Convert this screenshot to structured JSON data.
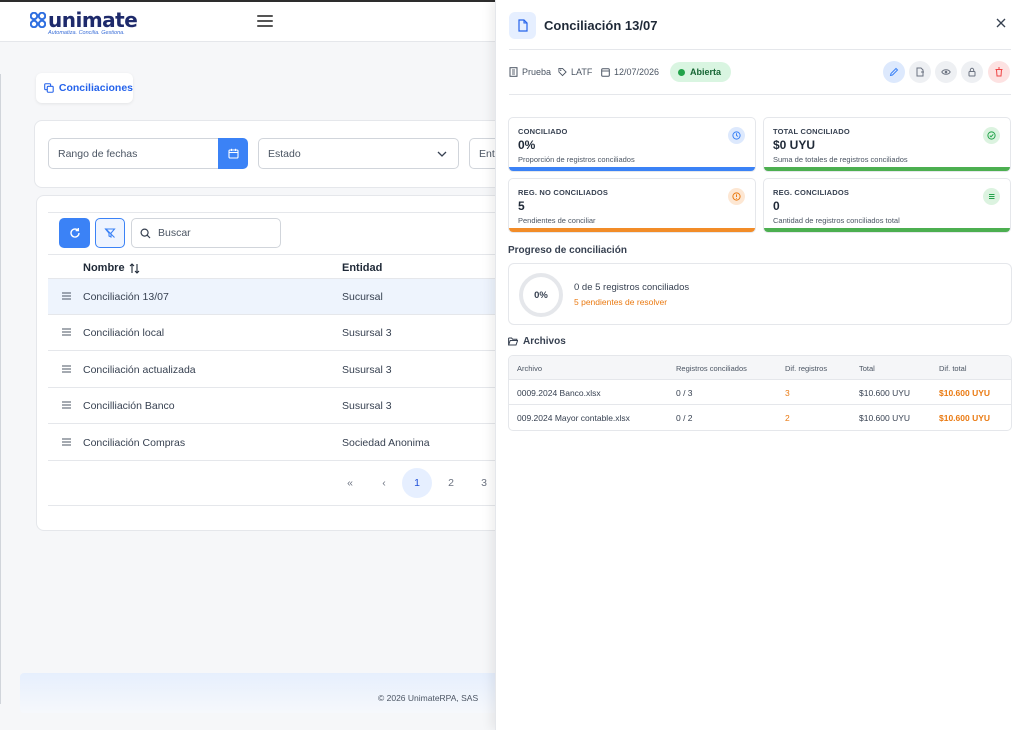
{
  "brand": {
    "name": "unimate",
    "tagline": "Automatiza. Concilia. Gestiona."
  },
  "breadcrumb": {
    "label": "Conciliaciones"
  },
  "filters": {
    "date_placeholder": "Rango de fechas",
    "estado_placeholder": "Estado",
    "entidad_placeholder": "Entidad",
    "entidad_visible": "Enti"
  },
  "toolbar": {
    "search_placeholder": "Buscar"
  },
  "table": {
    "headers": {
      "nombre": "Nombre",
      "entidad": "Entidad"
    },
    "rows": [
      {
        "nombre": "Conciliación 13/07",
        "entidad": "Sucursal",
        "selected": true
      },
      {
        "nombre": "Conciliación local",
        "entidad": "Susursal 3"
      },
      {
        "nombre": "Conciliación actualizada",
        "entidad": "Susursal 3"
      },
      {
        "nombre": "Concilliación Banco",
        "entidad": "Susursal 3"
      },
      {
        "nombre": "Conciliación Compras",
        "entidad": "Sociedad Anonima"
      }
    ]
  },
  "pagination": {
    "first": "«",
    "prev": "‹",
    "pages": [
      "1",
      "2",
      "3"
    ],
    "current": "1"
  },
  "footer": {
    "text": "© 2026 UnimateRPA, SAS"
  },
  "drawer": {
    "title": "Conciliación 13/07",
    "meta": {
      "empresa": "Prueba",
      "tag": "LATF",
      "fecha": "12/07/2026"
    },
    "status": "Abierta",
    "actions": [
      "edit",
      "export",
      "view",
      "lock",
      "delete"
    ],
    "stats": {
      "conciliado": {
        "label": "CONCILIADO",
        "value": "0%",
        "desc": "Proporción de registros conciliados",
        "color": "#3b82f6"
      },
      "total": {
        "label": "TOTAL CONCILIADO",
        "value": "$0 UYU",
        "desc": "Suma de totales de registros conciliados",
        "color": "#4caf50"
      },
      "no_conciliados": {
        "label": "REG. NO CONCILIADOS",
        "value": "5",
        "desc": "Pendientes de conciliar",
        "color": "#f28c28"
      },
      "conciliados": {
        "label": "REG. CONCILIADOS",
        "value": "0",
        "desc": "Cantidad de registros conciliados total",
        "color": "#4caf50"
      }
    },
    "progress": {
      "title": "Progreso de conciliación",
      "percent": "0%",
      "fraction": 0,
      "main": "0 de 5 registros conciliados",
      "sub": "5 pendientes de resolver"
    },
    "files": {
      "title": "Archivos",
      "headers": {
        "archivo": "Archivo",
        "registros": "Registros conciliados",
        "dif_registros": "Dif. registros",
        "total": "Total",
        "dif_total": "Dif. total"
      },
      "rows": [
        {
          "archivo": "0009.2024 Banco.xlsx",
          "registros": "0 / 3",
          "dif_registros": "3",
          "total": "$10.600 UYU",
          "dif_total": "$10.600 UYU"
        },
        {
          "archivo": "009.2024 Mayor contable.xlsx",
          "registros": "0 / 2",
          "dif_registros": "2",
          "total": "$10.600 UYU",
          "dif_total": "$10.600 UYU"
        }
      ]
    }
  },
  "colors": {
    "primary": "#3b82f6",
    "success": "#22a34a",
    "warning": "#ea7a12",
    "danger": "#ef4444"
  }
}
